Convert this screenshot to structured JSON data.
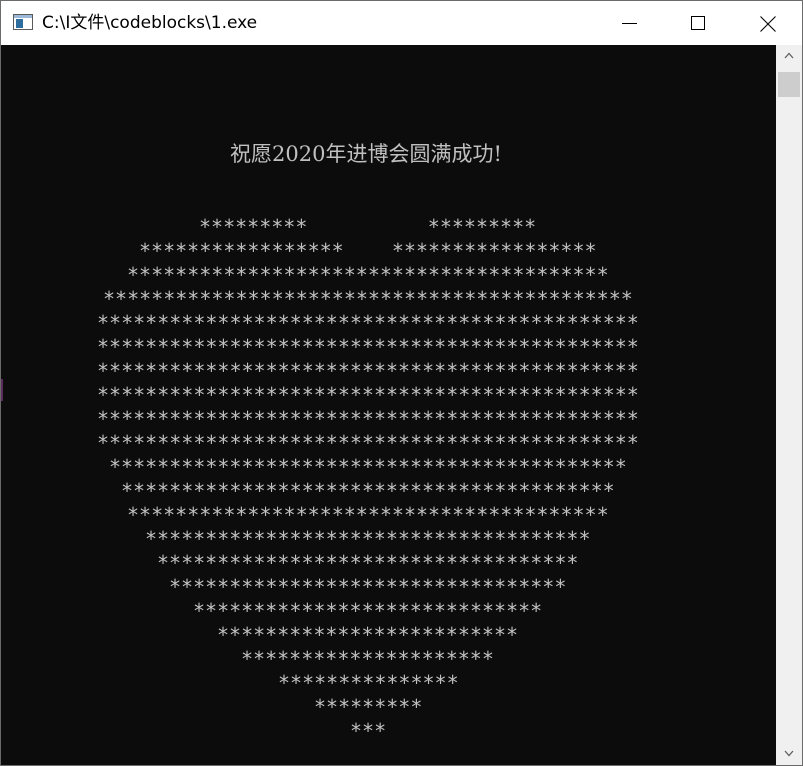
{
  "window": {
    "title": "C:\\I文件\\codeblocks\\1.exe"
  },
  "icons": {
    "app": "console-app-icon",
    "minimize": "minimize-icon",
    "maximize": "maximize-icon",
    "close": "close-icon",
    "scroll_up": "chevron-up-icon",
    "scroll_down": "chevron-down-icon"
  },
  "console": {
    "greeting": "祝愿2020年进博会圆满成功!",
    "heart": [
      "*********          *********",
      "*****************    *****************",
      "****************************************",
      "********************************************",
      "*********************************************",
      "*********************************************",
      "*********************************************",
      "*********************************************",
      "*********************************************",
      "*********************************************",
      "*******************************************",
      "*****************************************",
      "****************************************",
      "*************************************",
      "***********************************",
      "*********************************",
      "*****************************",
      "*************************",
      "*********************",
      "***************",
      "*********",
      "***"
    ]
  },
  "colors": {
    "console_background": "#0c0c0c",
    "console_text": "#c0c0c0",
    "titlebar_background": "#ffffff",
    "scrollbar_track": "#f0f0f0",
    "scrollbar_thumb": "#cdcdcd"
  }
}
